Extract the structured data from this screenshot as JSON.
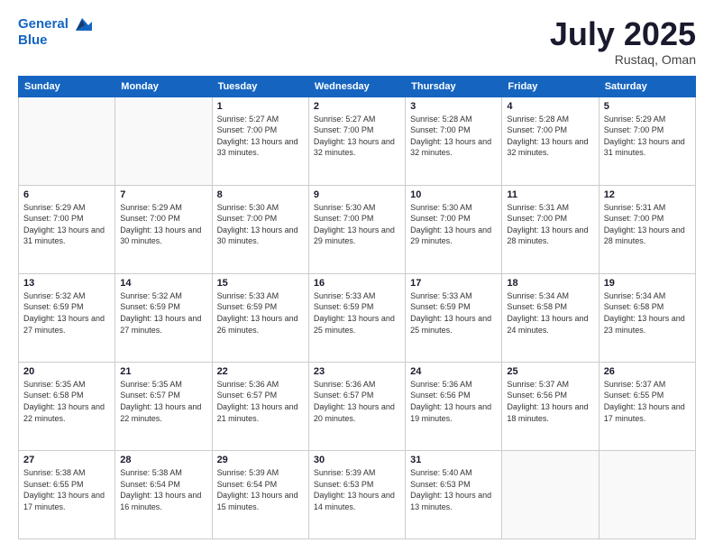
{
  "header": {
    "logo_line1": "General",
    "logo_line2": "Blue",
    "month_year": "July 2025",
    "location": "Rustaq, Oman"
  },
  "days_of_week": [
    "Sunday",
    "Monday",
    "Tuesday",
    "Wednesday",
    "Thursday",
    "Friday",
    "Saturday"
  ],
  "weeks": [
    [
      {
        "day": "",
        "info": ""
      },
      {
        "day": "",
        "info": ""
      },
      {
        "day": "1",
        "info": "Sunrise: 5:27 AM\nSunset: 7:00 PM\nDaylight: 13 hours\nand 33 minutes."
      },
      {
        "day": "2",
        "info": "Sunrise: 5:27 AM\nSunset: 7:00 PM\nDaylight: 13 hours\nand 32 minutes."
      },
      {
        "day": "3",
        "info": "Sunrise: 5:28 AM\nSunset: 7:00 PM\nDaylight: 13 hours\nand 32 minutes."
      },
      {
        "day": "4",
        "info": "Sunrise: 5:28 AM\nSunset: 7:00 PM\nDaylight: 13 hours\nand 32 minutes."
      },
      {
        "day": "5",
        "info": "Sunrise: 5:29 AM\nSunset: 7:00 PM\nDaylight: 13 hours\nand 31 minutes."
      }
    ],
    [
      {
        "day": "6",
        "info": "Sunrise: 5:29 AM\nSunset: 7:00 PM\nDaylight: 13 hours\nand 31 minutes."
      },
      {
        "day": "7",
        "info": "Sunrise: 5:29 AM\nSunset: 7:00 PM\nDaylight: 13 hours\nand 30 minutes."
      },
      {
        "day": "8",
        "info": "Sunrise: 5:30 AM\nSunset: 7:00 PM\nDaylight: 13 hours\nand 30 minutes."
      },
      {
        "day": "9",
        "info": "Sunrise: 5:30 AM\nSunset: 7:00 PM\nDaylight: 13 hours\nand 29 minutes."
      },
      {
        "day": "10",
        "info": "Sunrise: 5:30 AM\nSunset: 7:00 PM\nDaylight: 13 hours\nand 29 minutes."
      },
      {
        "day": "11",
        "info": "Sunrise: 5:31 AM\nSunset: 7:00 PM\nDaylight: 13 hours\nand 28 minutes."
      },
      {
        "day": "12",
        "info": "Sunrise: 5:31 AM\nSunset: 7:00 PM\nDaylight: 13 hours\nand 28 minutes."
      }
    ],
    [
      {
        "day": "13",
        "info": "Sunrise: 5:32 AM\nSunset: 6:59 PM\nDaylight: 13 hours\nand 27 minutes."
      },
      {
        "day": "14",
        "info": "Sunrise: 5:32 AM\nSunset: 6:59 PM\nDaylight: 13 hours\nand 27 minutes."
      },
      {
        "day": "15",
        "info": "Sunrise: 5:33 AM\nSunset: 6:59 PM\nDaylight: 13 hours\nand 26 minutes."
      },
      {
        "day": "16",
        "info": "Sunrise: 5:33 AM\nSunset: 6:59 PM\nDaylight: 13 hours\nand 25 minutes."
      },
      {
        "day": "17",
        "info": "Sunrise: 5:33 AM\nSunset: 6:59 PM\nDaylight: 13 hours\nand 25 minutes."
      },
      {
        "day": "18",
        "info": "Sunrise: 5:34 AM\nSunset: 6:58 PM\nDaylight: 13 hours\nand 24 minutes."
      },
      {
        "day": "19",
        "info": "Sunrise: 5:34 AM\nSunset: 6:58 PM\nDaylight: 13 hours\nand 23 minutes."
      }
    ],
    [
      {
        "day": "20",
        "info": "Sunrise: 5:35 AM\nSunset: 6:58 PM\nDaylight: 13 hours\nand 22 minutes."
      },
      {
        "day": "21",
        "info": "Sunrise: 5:35 AM\nSunset: 6:57 PM\nDaylight: 13 hours\nand 22 minutes."
      },
      {
        "day": "22",
        "info": "Sunrise: 5:36 AM\nSunset: 6:57 PM\nDaylight: 13 hours\nand 21 minutes."
      },
      {
        "day": "23",
        "info": "Sunrise: 5:36 AM\nSunset: 6:57 PM\nDaylight: 13 hours\nand 20 minutes."
      },
      {
        "day": "24",
        "info": "Sunrise: 5:36 AM\nSunset: 6:56 PM\nDaylight: 13 hours\nand 19 minutes."
      },
      {
        "day": "25",
        "info": "Sunrise: 5:37 AM\nSunset: 6:56 PM\nDaylight: 13 hours\nand 18 minutes."
      },
      {
        "day": "26",
        "info": "Sunrise: 5:37 AM\nSunset: 6:55 PM\nDaylight: 13 hours\nand 17 minutes."
      }
    ],
    [
      {
        "day": "27",
        "info": "Sunrise: 5:38 AM\nSunset: 6:55 PM\nDaylight: 13 hours\nand 17 minutes."
      },
      {
        "day": "28",
        "info": "Sunrise: 5:38 AM\nSunset: 6:54 PM\nDaylight: 13 hours\nand 16 minutes."
      },
      {
        "day": "29",
        "info": "Sunrise: 5:39 AM\nSunset: 6:54 PM\nDaylight: 13 hours\nand 15 minutes."
      },
      {
        "day": "30",
        "info": "Sunrise: 5:39 AM\nSunset: 6:53 PM\nDaylight: 13 hours\nand 14 minutes."
      },
      {
        "day": "31",
        "info": "Sunrise: 5:40 AM\nSunset: 6:53 PM\nDaylight: 13 hours\nand 13 minutes."
      },
      {
        "day": "",
        "info": ""
      },
      {
        "day": "",
        "info": ""
      }
    ]
  ]
}
